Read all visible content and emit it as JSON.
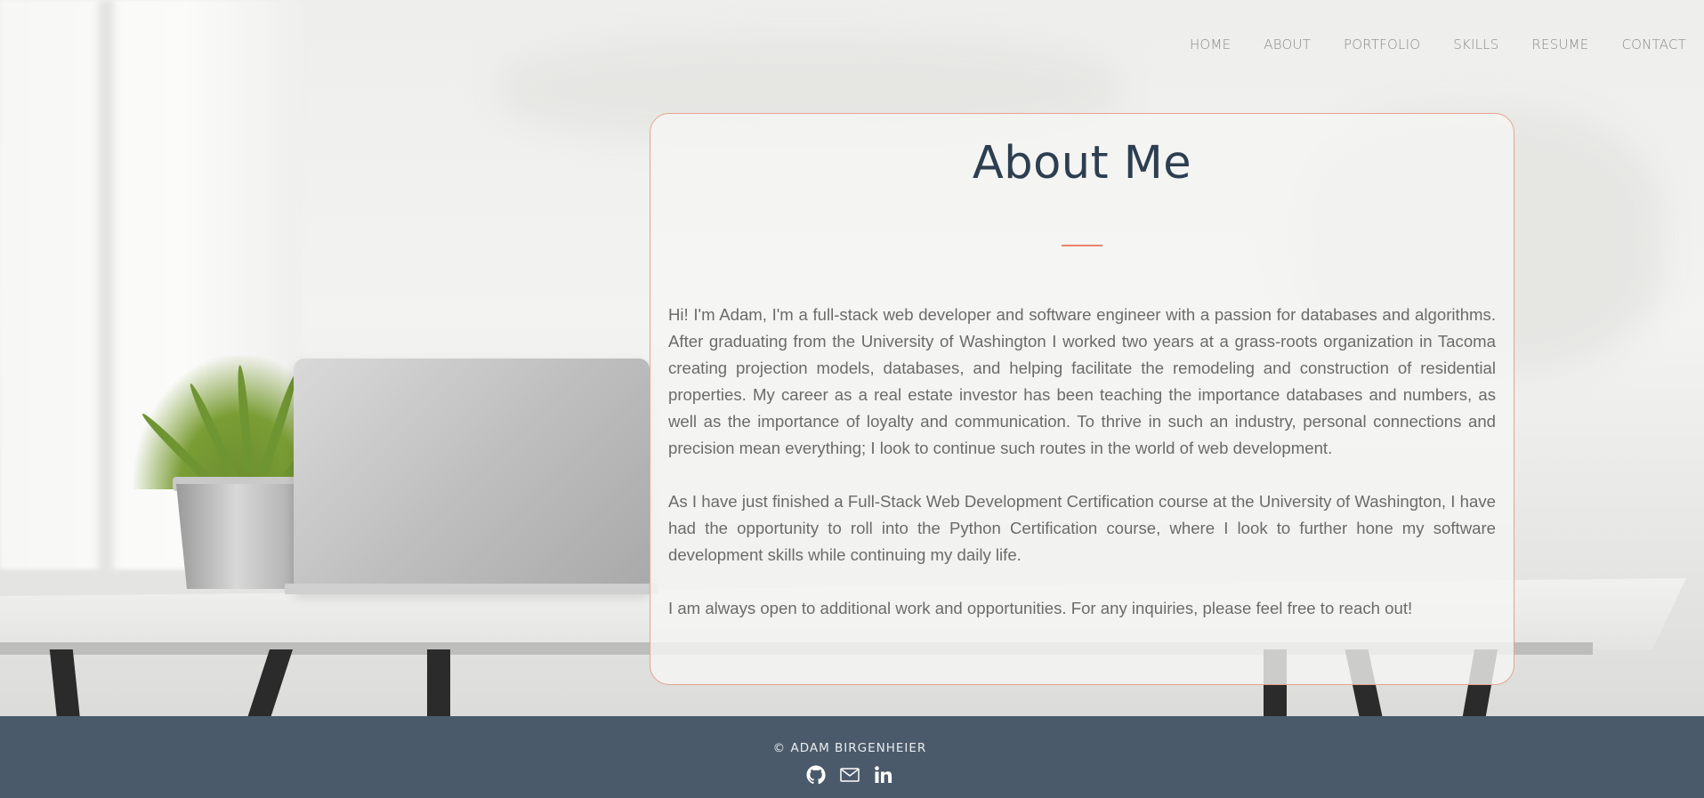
{
  "nav": {
    "items": [
      {
        "label": "HOME"
      },
      {
        "label": "ABOUT"
      },
      {
        "label": "PORTFOLIO"
      },
      {
        "label": "SKILLS"
      },
      {
        "label": "RESUME"
      },
      {
        "label": "CONTACT"
      }
    ]
  },
  "about": {
    "title": "About Me",
    "paragraphs": [
      "Hi! I'm Adam, I'm a full-stack web developer and software engineer with a passion for databases and algorithms. After graduating from the University of Washington I worked two years at a grass-roots organization in Tacoma creating projection models, databases, and helping facilitate the remodeling and construction of residential properties. My career as a real estate investor has been teaching the importance databases and numbers, as well as the importance of loyalty and communication. To thrive in such an industry, personal connections and precision mean everything; I look to continue such routes in the world of web development.",
      "As I have just finished a Full-Stack Web Development Certification course at the University of Washington, I have had the opportunity to roll into the Python Certification course, where I look to further hone my software development skills while continuing my daily life.",
      "I am always open to additional work and opportunities. For any inquiries, please feel free to reach out!"
    ]
  },
  "footer": {
    "copyright": "© ADAM BIRGENHEIER",
    "icons": [
      "github-icon",
      "email-icon",
      "linkedin-icon"
    ]
  },
  "colors": {
    "accent": "#e8836b",
    "title": "#2c3e50",
    "footer_bg": "#4b5a6a"
  }
}
